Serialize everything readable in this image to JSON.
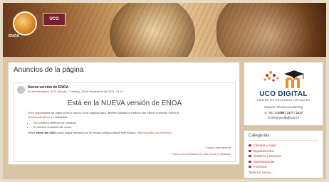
{
  "banner": {
    "logo1_text": "ENOA",
    "logo2_text": "UCO"
  },
  "main": {
    "page_title": "Anuncios de la página",
    "post": {
      "title": "Nueva versión de ENOA",
      "meta_prefix": "de",
      "author": "Administrador UVIS Moodle",
      "date": "- Tuesday, 28 de September de 2021, 13:16",
      "heading": "Está en la NUEVA versión de ENOA",
      "para1": "Si es responsable de algún curso y aún no lo ha migrado aquí, deberá solicitar la creación del mismo enviando correo a",
      "email": "informoodle@uco.es",
      "para1_suffix": "indicando:",
      "bullets": [
        "Su nombre y teléfono de contacto.",
        "El nombre completo del curso."
      ],
      "para2_prefix": "Hasta",
      "para2_bold": "enero del 2022",
      "para2_mid": "podrá seguir entrando en la versión antigua desde este enlace:",
      "url": "http://moodle.uco.es/enoa3",
      "permalink": "Enlace permanente",
      "reply_link": "Hacer un comentario en este tema",
      "reply_count": "(0 réplicas)"
    }
  },
  "brand": {
    "name": "UCO DIGITAL",
    "subtitle": "CENTRO DE RECURSOS VIRTUALES",
    "support_title": "Soporte Técnico eLearning",
    "phone_label": "957 21",
    "phone_bold": "2086 / 2177 / 2137",
    "email": "informoodle@uco.es"
  },
  "categories": {
    "title": "Categorías",
    "items": [
      "Cátedras y Aulas",
      "Departamentos",
      "Gobierno y Servicios",
      "Representación",
      "Proyectos"
    ],
    "all_label": "Todos los cursos ..."
  },
  "colors": {
    "accent": "#c0392b",
    "brand_blue": "#1e3a6b",
    "brand_orange": "#f28c1e"
  }
}
